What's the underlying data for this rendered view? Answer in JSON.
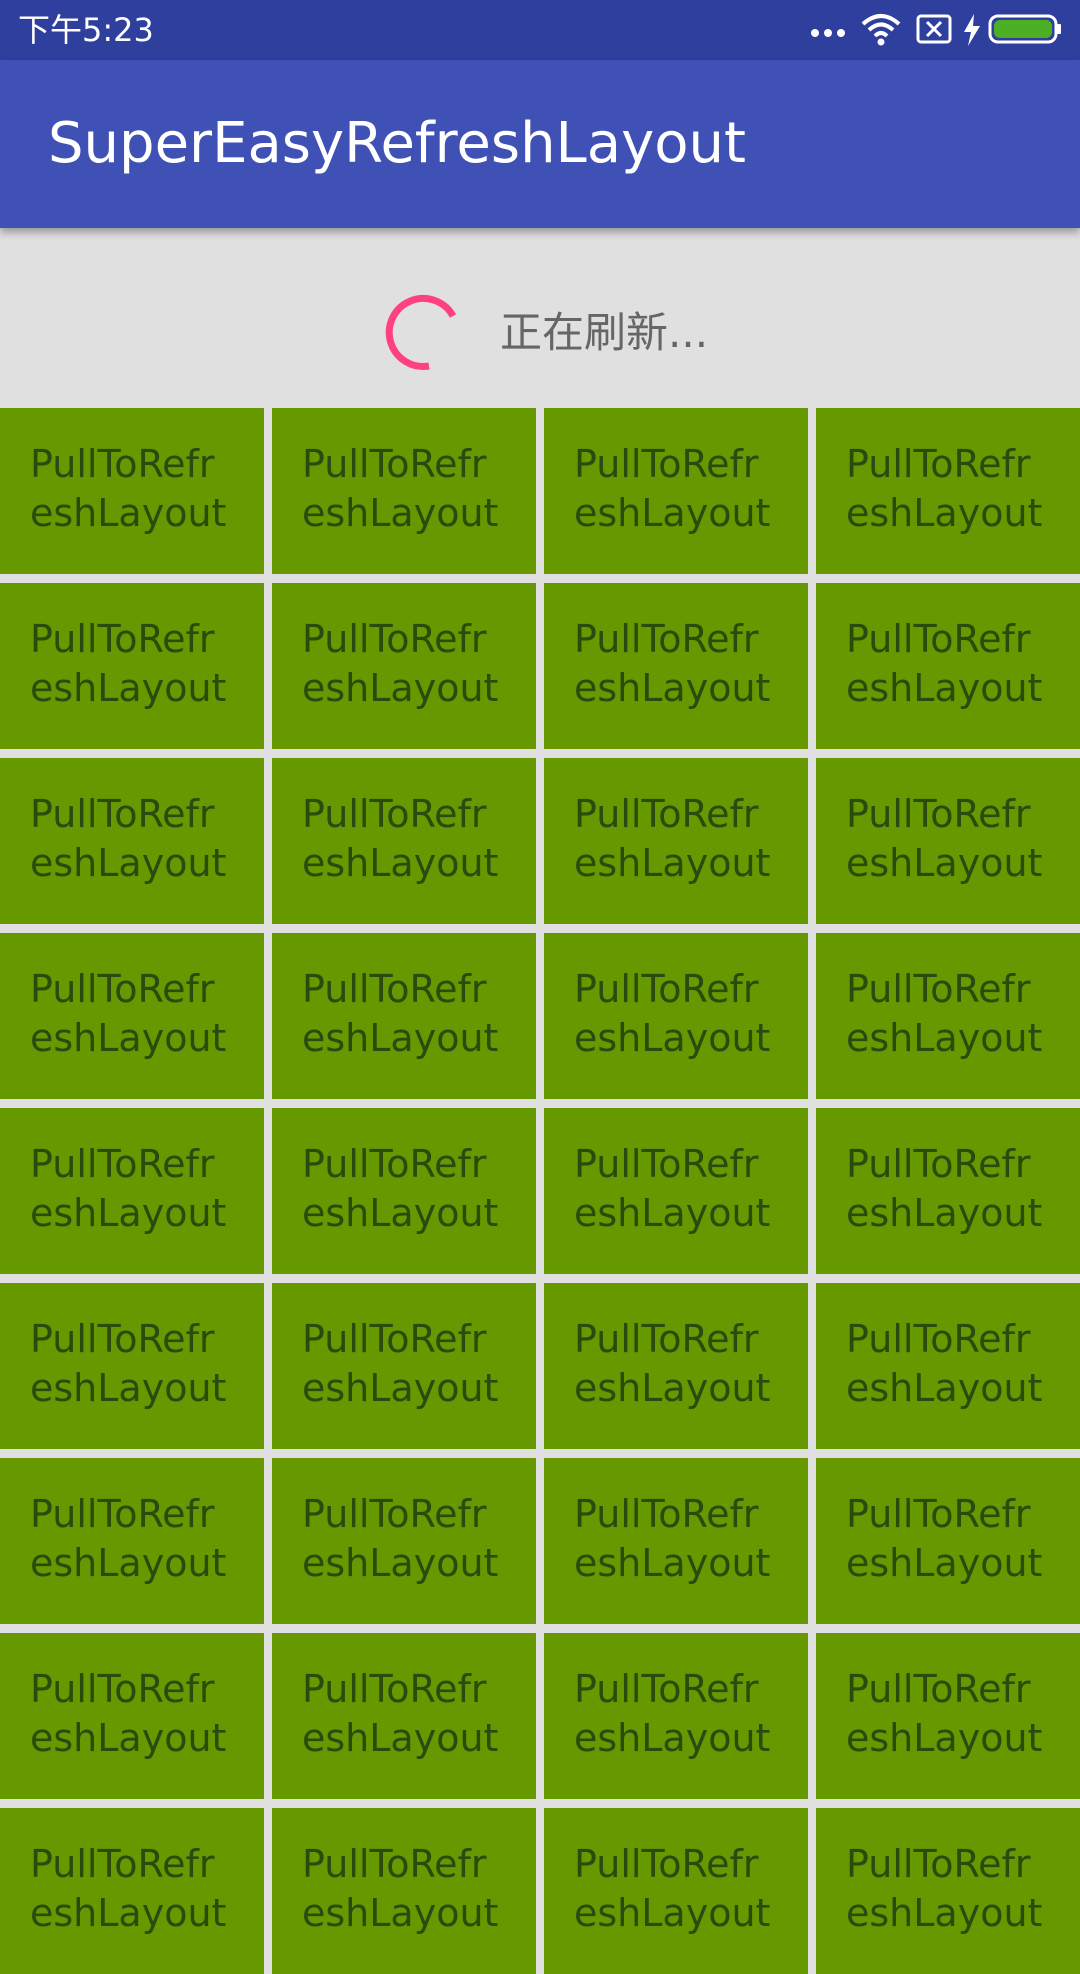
{
  "status_bar": {
    "time": "下午5:23",
    "icons": [
      "more-dots-icon",
      "wifi-icon",
      "sim-off-icon",
      "charging-bolt-icon",
      "battery-icon"
    ],
    "battery_color": "#4caf24"
  },
  "app_bar": {
    "title": "SuperEasyRefreshLayout",
    "color": "#3f51b5"
  },
  "refresh_header": {
    "text": "正在刷新...",
    "spinner_color": "#ff4081"
  },
  "grid": {
    "item_color": "#669900",
    "items": [
      {
        "line1": "PullToRefr",
        "line2": "eshLayout"
      },
      {
        "line1": "PullToRefr",
        "line2": "eshLayout"
      },
      {
        "line1": "PullToRefr",
        "line2": "eshLayout"
      },
      {
        "line1": "PullToRefr",
        "line2": "eshLayout"
      },
      {
        "line1": "PullToRefr",
        "line2": "eshLayout"
      },
      {
        "line1": "PullToRefr",
        "line2": "eshLayout"
      },
      {
        "line1": "PullToRefr",
        "line2": "eshLayout"
      },
      {
        "line1": "PullToRefr",
        "line2": "eshLayout"
      },
      {
        "line1": "PullToRefr",
        "line2": "eshLayout"
      },
      {
        "line1": "PullToRefr",
        "line2": "eshLayout"
      },
      {
        "line1": "PullToRefr",
        "line2": "eshLayout"
      },
      {
        "line1": "PullToRefr",
        "line2": "eshLayout"
      },
      {
        "line1": "PullToRefr",
        "line2": "eshLayout"
      },
      {
        "line1": "PullToRefr",
        "line2": "eshLayout"
      },
      {
        "line1": "PullToRefr",
        "line2": "eshLayout"
      },
      {
        "line1": "PullToRefr",
        "line2": "eshLayout"
      },
      {
        "line1": "PullToRefr",
        "line2": "eshLayout"
      },
      {
        "line1": "PullToRefr",
        "line2": "eshLayout"
      },
      {
        "line1": "PullToRefr",
        "line2": "eshLayout"
      },
      {
        "line1": "PullToRefr",
        "line2": "eshLayout"
      },
      {
        "line1": "PullToRefr",
        "line2": "eshLayout"
      },
      {
        "line1": "PullToRefr",
        "line2": "eshLayout"
      },
      {
        "line1": "PullToRefr",
        "line2": "eshLayout"
      },
      {
        "line1": "PullToRefr",
        "line2": "eshLayout"
      },
      {
        "line1": "PullToRefr",
        "line2": "eshLayout"
      },
      {
        "line1": "PullToRefr",
        "line2": "eshLayout"
      },
      {
        "line1": "PullToRefr",
        "line2": "eshLayout"
      },
      {
        "line1": "PullToRefr",
        "line2": "eshLayout"
      },
      {
        "line1": "PullToRefr",
        "line2": "eshLayout"
      },
      {
        "line1": "PullToRefr",
        "line2": "eshLayout"
      },
      {
        "line1": "PullToRefr",
        "line2": "eshLayout"
      },
      {
        "line1": "PullToRefr",
        "line2": "eshLayout"
      },
      {
        "line1": "PullToRefr",
        "line2": "eshLayout"
      },
      {
        "line1": "PullToRefr",
        "line2": "eshLayout"
      },
      {
        "line1": "PullToRefr",
        "line2": "eshLayout"
      },
      {
        "line1": "PullToRefr",
        "line2": "eshLayout"
      }
    ]
  }
}
